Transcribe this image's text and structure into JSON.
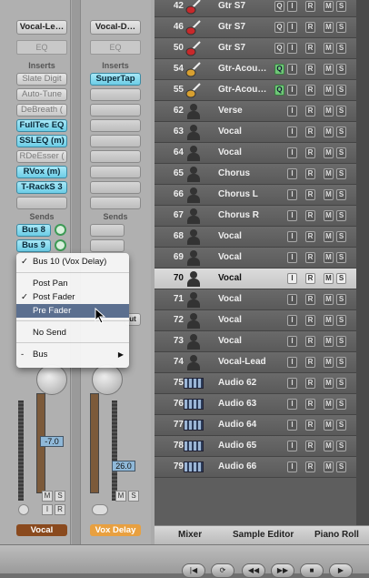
{
  "strip1": {
    "output": "Vocal-Le…",
    "eq": "EQ",
    "inserts_label": "Inserts",
    "inserts": [
      "Slate Digit",
      "Auto-Tune",
      "DeBreath (",
      "FullTec EQ",
      "SSLEQ (m)",
      "RDeEsser (",
      "RVox (m)",
      "T-RackS 3"
    ],
    "sends_label": "Sends",
    "sends": [
      "Bus 8",
      "Bus 9"
    ],
    "fader_value": "-7.0",
    "mute": "M",
    "solo": "S",
    "input": "I",
    "record": "R",
    "name": "Vocal",
    "name_color": "#8a4a1e"
  },
  "strip2": {
    "output": "Vocal-D…",
    "eq": "EQ",
    "inserts_label": "Inserts",
    "inserts": [
      "SuperTap"
    ],
    "sends_label": "Sends",
    "fader_value": "26.0",
    "mute": "M",
    "solo": "S",
    "partial_label": "ut",
    "name": "Vox Delay",
    "name_color": "#e8a040"
  },
  "popup": {
    "items": [
      {
        "label": "Bus 10  (Vox Delay)",
        "checked": true
      },
      {
        "label": "Post Pan",
        "checked": false
      },
      {
        "label": "Post Fader",
        "checked": true
      },
      {
        "label": "Pre Fader",
        "checked": false,
        "selected": true
      },
      {
        "label": "No Send",
        "checked": false
      },
      {
        "label": "Bus",
        "dash": "-",
        "submenu": "▶"
      }
    ],
    "check_mark": "✓"
  },
  "tracks": [
    {
      "num": "42",
      "name": "Gtr S7",
      "icon": "guitar-icon",
      "q": "Q",
      "i": "I",
      "r": "R",
      "m": "M",
      "s": "S"
    },
    {
      "num": "46",
      "name": "Gtr S7",
      "icon": "guitar-icon",
      "q": "Q",
      "i": "I",
      "r": "R",
      "m": "M",
      "s": "S"
    },
    {
      "num": "50",
      "name": "Gtr S7",
      "icon": "guitar-icon",
      "q": "Q",
      "i": "I",
      "r": "R",
      "m": "M",
      "s": "S"
    },
    {
      "num": "54",
      "name": "Gtr-Acou…",
      "icon": "acoustic-guitar-icon",
      "q": "Q",
      "q_active": true,
      "i": "I",
      "r": "R",
      "m": "M",
      "s": "S"
    },
    {
      "num": "55",
      "name": "Gtr-Acou…",
      "icon": "acoustic-guitar-icon",
      "q": "Q",
      "q_active": true,
      "i": "I",
      "r": "R",
      "m": "M",
      "s": "S"
    },
    {
      "num": "62",
      "name": "Verse",
      "icon": "person-icon",
      "i": "I",
      "r": "R",
      "m": "M",
      "s": "S"
    },
    {
      "num": "63",
      "name": "Vocal",
      "icon": "person-icon",
      "i": "I",
      "r": "R",
      "m": "M",
      "s": "S"
    },
    {
      "num": "64",
      "name": "Vocal",
      "icon": "person-icon",
      "i": "I",
      "r": "R",
      "m": "M",
      "s": "S"
    },
    {
      "num": "65",
      "name": "Chorus",
      "icon": "person-icon",
      "i": "I",
      "r": "R",
      "m": "M",
      "s": "S"
    },
    {
      "num": "66",
      "name": "Chorus L",
      "icon": "person-icon",
      "i": "I",
      "r": "R",
      "m": "M",
      "s": "S"
    },
    {
      "num": "67",
      "name": "Chorus R",
      "icon": "person-icon",
      "i": "I",
      "r": "R",
      "m": "M",
      "s": "S"
    },
    {
      "num": "68",
      "name": "Vocal",
      "icon": "person-icon",
      "i": "I",
      "r": "R",
      "m": "M",
      "s": "S"
    },
    {
      "num": "69",
      "name": "Vocal",
      "icon": "person-icon",
      "i": "I",
      "r": "R",
      "m": "M",
      "s": "S"
    },
    {
      "num": "70",
      "name": "Vocal",
      "icon": "person-icon",
      "i": "I",
      "r": "R",
      "m": "M",
      "s": "S",
      "selected": true
    },
    {
      "num": "71",
      "name": "Vocal",
      "icon": "person-icon",
      "i": "I",
      "r": "R",
      "m": "M",
      "s": "S"
    },
    {
      "num": "72",
      "name": "Vocal",
      "icon": "person-icon",
      "i": "I",
      "r": "R",
      "m": "M",
      "s": "S"
    },
    {
      "num": "73",
      "name": "Vocal",
      "icon": "person-icon",
      "i": "I",
      "r": "R",
      "m": "M",
      "s": "S"
    },
    {
      "num": "74",
      "name": "Vocal-Lead",
      "icon": "person-icon",
      "i": "I",
      "r": "R",
      "m": "M",
      "s": "S"
    },
    {
      "num": "75",
      "name": "Audio 62",
      "icon": "audio-icon",
      "i": "I",
      "r": "R",
      "m": "M",
      "s": "S"
    },
    {
      "num": "76",
      "name": "Audio 63",
      "icon": "audio-icon",
      "i": "I",
      "r": "R",
      "m": "M",
      "s": "S"
    },
    {
      "num": "77",
      "name": "Audio 64",
      "icon": "audio-icon",
      "i": "I",
      "r": "R",
      "m": "M",
      "s": "S"
    },
    {
      "num": "78",
      "name": "Audio 65",
      "icon": "audio-icon",
      "i": "I",
      "r": "R",
      "m": "M",
      "s": "S"
    },
    {
      "num": "79",
      "name": "Audio 66",
      "icon": "audio-icon",
      "i": "I",
      "r": "R",
      "m": "M",
      "s": "S"
    }
  ],
  "tabs": [
    "Mixer",
    "Sample Editor",
    "Piano Roll"
  ]
}
